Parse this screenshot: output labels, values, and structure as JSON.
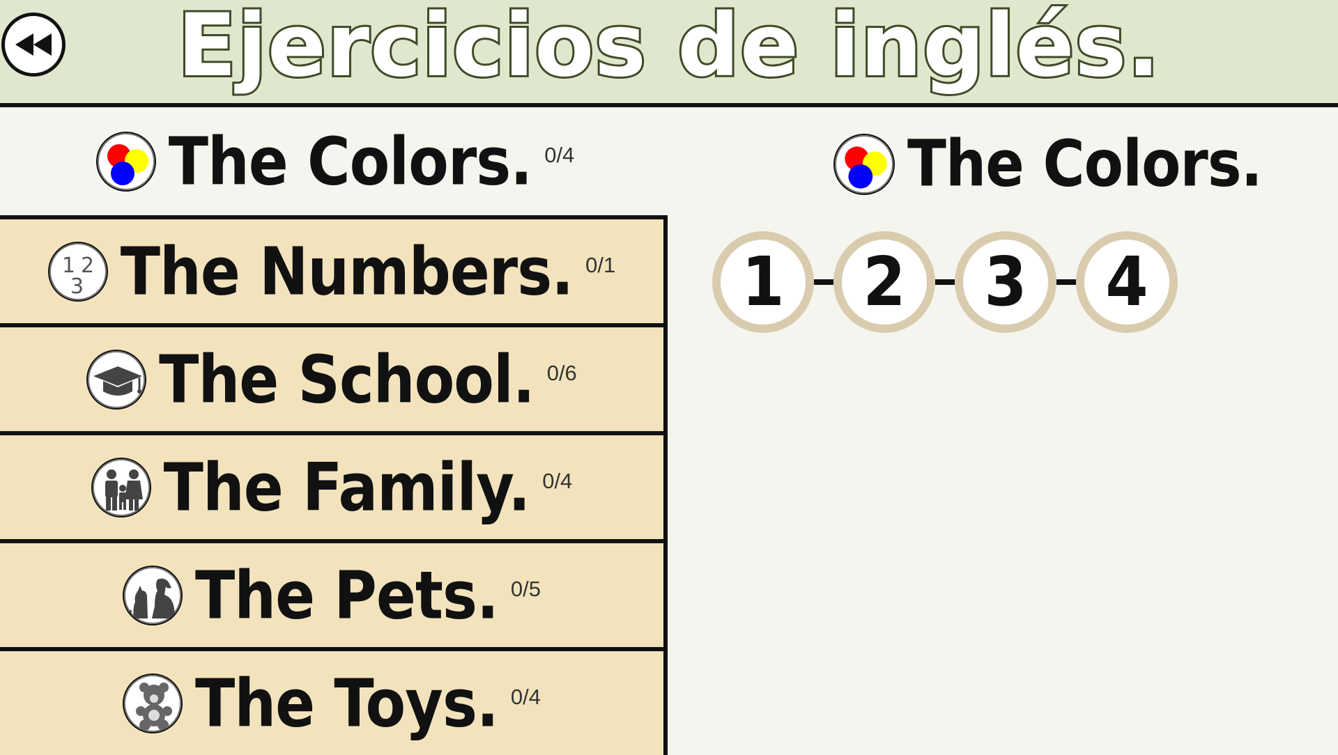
{
  "header": {
    "title": "Ejercicios de inglés.",
    "back_icon": "rewind-icon"
  },
  "categories": [
    {
      "label": "The Colors.",
      "progress": "0/4",
      "icon": "colors-icon",
      "selected": true
    },
    {
      "label": "The Numbers.",
      "progress": "0/1",
      "icon": "numbers-icon",
      "selected": false
    },
    {
      "label": "The School.",
      "progress": "0/6",
      "icon": "graduation-cap-icon",
      "selected": false
    },
    {
      "label": "The Family.",
      "progress": "0/4",
      "icon": "family-icon",
      "selected": false
    },
    {
      "label": "The Pets.",
      "progress": "0/5",
      "icon": "pets-icon",
      "selected": false
    },
    {
      "label": "The Toys.",
      "progress": "0/4",
      "icon": "teddy-bear-icon",
      "selected": false
    }
  ],
  "detail": {
    "title": "The Colors.",
    "icon": "colors-icon",
    "levels": [
      "1",
      "2",
      "3",
      "4"
    ]
  },
  "colors": {
    "header_bg": "#dfe8cf",
    "list_bg": "#f3e3bd",
    "page_bg": "#f5f5ef",
    "level_ring": "#d9ccae",
    "red": "#ff0000",
    "yellow": "#ffff00",
    "blue": "#0000ff"
  }
}
